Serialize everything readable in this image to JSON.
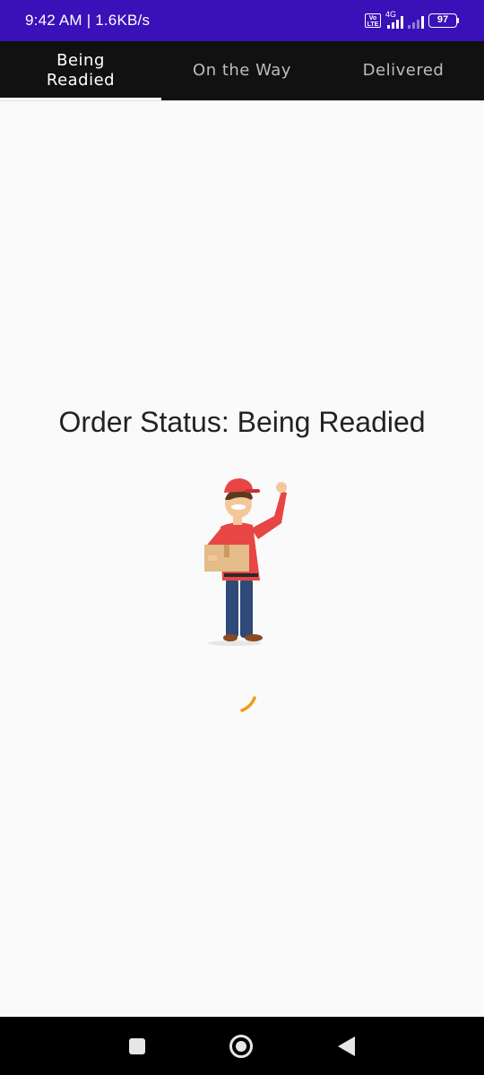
{
  "status_bar": {
    "time_speed": "9:42 AM | 1.6KB/s",
    "volte_label": "Vo LTE",
    "network_type": "4G",
    "battery_level": "97"
  },
  "tabs": [
    {
      "label": "Being Readied",
      "active": true
    },
    {
      "label": "On the Way",
      "active": false
    },
    {
      "label": "Delivered",
      "active": false
    }
  ],
  "main": {
    "order_status_text": "Order Status: Being Readied",
    "illustration_icon": "delivery-man-with-package",
    "loading_indicator": "spinner"
  },
  "colors": {
    "status_bar_bg": "#3a10b8",
    "tab_bar_bg": "#111111",
    "page_bg": "#fafafa",
    "spinner": "#f39c12",
    "nav_bar_bg": "#000000"
  },
  "nav_bar": {
    "recent_icon": "square-recent-apps-icon",
    "home_icon": "circle-home-icon",
    "back_icon": "triangle-back-icon"
  }
}
